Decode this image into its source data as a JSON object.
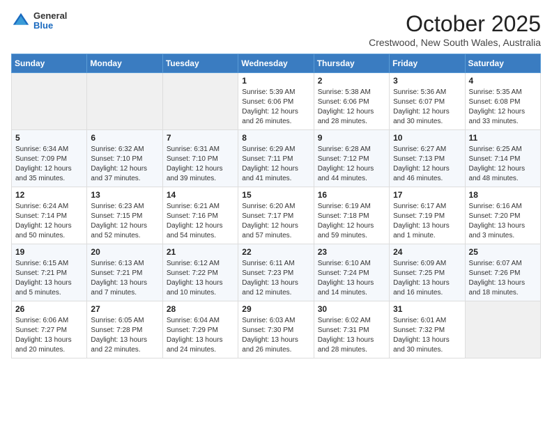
{
  "logo": {
    "general": "General",
    "blue": "Blue"
  },
  "header": {
    "month": "October 2025",
    "location": "Crestwood, New South Wales, Australia"
  },
  "weekdays": [
    "Sunday",
    "Monday",
    "Tuesday",
    "Wednesday",
    "Thursday",
    "Friday",
    "Saturday"
  ],
  "weeks": [
    [
      {
        "day": "",
        "info": ""
      },
      {
        "day": "",
        "info": ""
      },
      {
        "day": "",
        "info": ""
      },
      {
        "day": "1",
        "info": "Sunrise: 5:39 AM\nSunset: 6:06 PM\nDaylight: 12 hours\nand 26 minutes."
      },
      {
        "day": "2",
        "info": "Sunrise: 5:38 AM\nSunset: 6:06 PM\nDaylight: 12 hours\nand 28 minutes."
      },
      {
        "day": "3",
        "info": "Sunrise: 5:36 AM\nSunset: 6:07 PM\nDaylight: 12 hours\nand 30 minutes."
      },
      {
        "day": "4",
        "info": "Sunrise: 5:35 AM\nSunset: 6:08 PM\nDaylight: 12 hours\nand 33 minutes."
      }
    ],
    [
      {
        "day": "5",
        "info": "Sunrise: 6:34 AM\nSunset: 7:09 PM\nDaylight: 12 hours\nand 35 minutes."
      },
      {
        "day": "6",
        "info": "Sunrise: 6:32 AM\nSunset: 7:10 PM\nDaylight: 12 hours\nand 37 minutes."
      },
      {
        "day": "7",
        "info": "Sunrise: 6:31 AM\nSunset: 7:10 PM\nDaylight: 12 hours\nand 39 minutes."
      },
      {
        "day": "8",
        "info": "Sunrise: 6:29 AM\nSunset: 7:11 PM\nDaylight: 12 hours\nand 41 minutes."
      },
      {
        "day": "9",
        "info": "Sunrise: 6:28 AM\nSunset: 7:12 PM\nDaylight: 12 hours\nand 44 minutes."
      },
      {
        "day": "10",
        "info": "Sunrise: 6:27 AM\nSunset: 7:13 PM\nDaylight: 12 hours\nand 46 minutes."
      },
      {
        "day": "11",
        "info": "Sunrise: 6:25 AM\nSunset: 7:14 PM\nDaylight: 12 hours\nand 48 minutes."
      }
    ],
    [
      {
        "day": "12",
        "info": "Sunrise: 6:24 AM\nSunset: 7:14 PM\nDaylight: 12 hours\nand 50 minutes."
      },
      {
        "day": "13",
        "info": "Sunrise: 6:23 AM\nSunset: 7:15 PM\nDaylight: 12 hours\nand 52 minutes."
      },
      {
        "day": "14",
        "info": "Sunrise: 6:21 AM\nSunset: 7:16 PM\nDaylight: 12 hours\nand 54 minutes."
      },
      {
        "day": "15",
        "info": "Sunrise: 6:20 AM\nSunset: 7:17 PM\nDaylight: 12 hours\nand 57 minutes."
      },
      {
        "day": "16",
        "info": "Sunrise: 6:19 AM\nSunset: 7:18 PM\nDaylight: 12 hours\nand 59 minutes."
      },
      {
        "day": "17",
        "info": "Sunrise: 6:17 AM\nSunset: 7:19 PM\nDaylight: 13 hours\nand 1 minute."
      },
      {
        "day": "18",
        "info": "Sunrise: 6:16 AM\nSunset: 7:20 PM\nDaylight: 13 hours\nand 3 minutes."
      }
    ],
    [
      {
        "day": "19",
        "info": "Sunrise: 6:15 AM\nSunset: 7:21 PM\nDaylight: 13 hours\nand 5 minutes."
      },
      {
        "day": "20",
        "info": "Sunrise: 6:13 AM\nSunset: 7:21 PM\nDaylight: 13 hours\nand 7 minutes."
      },
      {
        "day": "21",
        "info": "Sunrise: 6:12 AM\nSunset: 7:22 PM\nDaylight: 13 hours\nand 10 minutes."
      },
      {
        "day": "22",
        "info": "Sunrise: 6:11 AM\nSunset: 7:23 PM\nDaylight: 13 hours\nand 12 minutes."
      },
      {
        "day": "23",
        "info": "Sunrise: 6:10 AM\nSunset: 7:24 PM\nDaylight: 13 hours\nand 14 minutes."
      },
      {
        "day": "24",
        "info": "Sunrise: 6:09 AM\nSunset: 7:25 PM\nDaylight: 13 hours\nand 16 minutes."
      },
      {
        "day": "25",
        "info": "Sunrise: 6:07 AM\nSunset: 7:26 PM\nDaylight: 13 hours\nand 18 minutes."
      }
    ],
    [
      {
        "day": "26",
        "info": "Sunrise: 6:06 AM\nSunset: 7:27 PM\nDaylight: 13 hours\nand 20 minutes."
      },
      {
        "day": "27",
        "info": "Sunrise: 6:05 AM\nSunset: 7:28 PM\nDaylight: 13 hours\nand 22 minutes."
      },
      {
        "day": "28",
        "info": "Sunrise: 6:04 AM\nSunset: 7:29 PM\nDaylight: 13 hours\nand 24 minutes."
      },
      {
        "day": "29",
        "info": "Sunrise: 6:03 AM\nSunset: 7:30 PM\nDaylight: 13 hours\nand 26 minutes."
      },
      {
        "day": "30",
        "info": "Sunrise: 6:02 AM\nSunset: 7:31 PM\nDaylight: 13 hours\nand 28 minutes."
      },
      {
        "day": "31",
        "info": "Sunrise: 6:01 AM\nSunset: 7:32 PM\nDaylight: 13 hours\nand 30 minutes."
      },
      {
        "day": "",
        "info": ""
      }
    ]
  ]
}
